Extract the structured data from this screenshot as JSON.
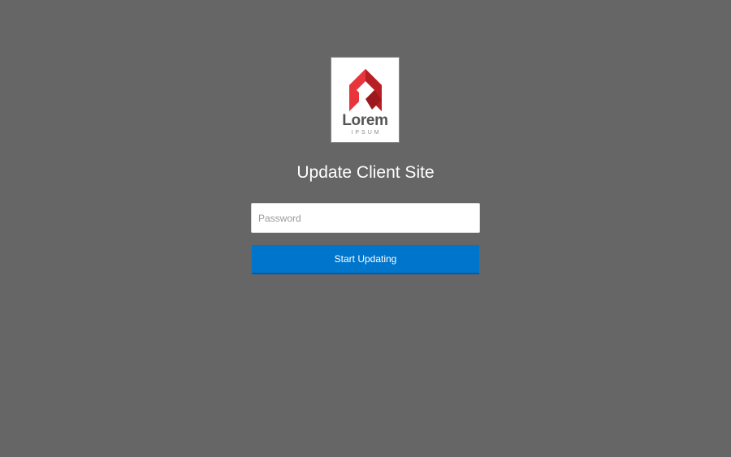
{
  "logo": {
    "word": "Lorem",
    "sub": "IPSUM",
    "icon": "red-house-diamond-logo-icon",
    "accent_color": "#d7262d"
  },
  "form": {
    "title": "Update Client Site",
    "password_placeholder": "Password",
    "password_value": "",
    "submit_label": "Start Updating"
  },
  "colors": {
    "background": "#666666",
    "button": "#0075cc"
  }
}
